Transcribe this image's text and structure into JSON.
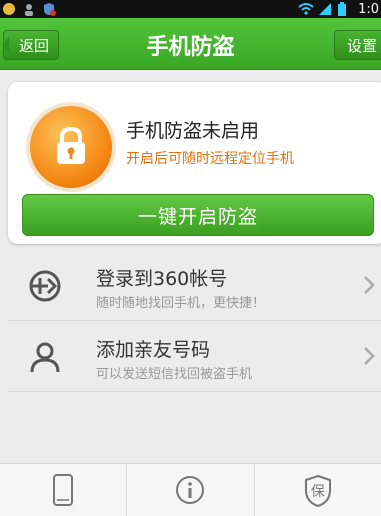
{
  "status_bar": {
    "time": "1:0",
    "icons": [
      "app-icon",
      "user-icon",
      "shield-icon",
      "wifi-icon",
      "signal-icon",
      "battery-icon"
    ]
  },
  "header": {
    "back_label": "返回",
    "title": "手机防盗",
    "settings_label": "设置"
  },
  "status_card": {
    "title": "手机防盗未启用",
    "subtitle": "开启后可随时远程定位手机",
    "enable_button": "一键开启防盗"
  },
  "list": {
    "items": [
      {
        "title": "登录到360帐号",
        "subtitle": "随时随地找回手机，更快捷！",
        "icon": "add-icon"
      },
      {
        "title": "添加亲友号码",
        "subtitle": "可以发送短信找回被盗手机",
        "icon": "person-icon"
      }
    ]
  },
  "bottom_tabs": [
    {
      "icon": "phone-icon"
    },
    {
      "icon": "info-icon"
    },
    {
      "icon": "shield-icon",
      "text": "保"
    }
  ],
  "colors": {
    "brand_green": "#3aa625",
    "accent_orange": "#e3700f"
  }
}
